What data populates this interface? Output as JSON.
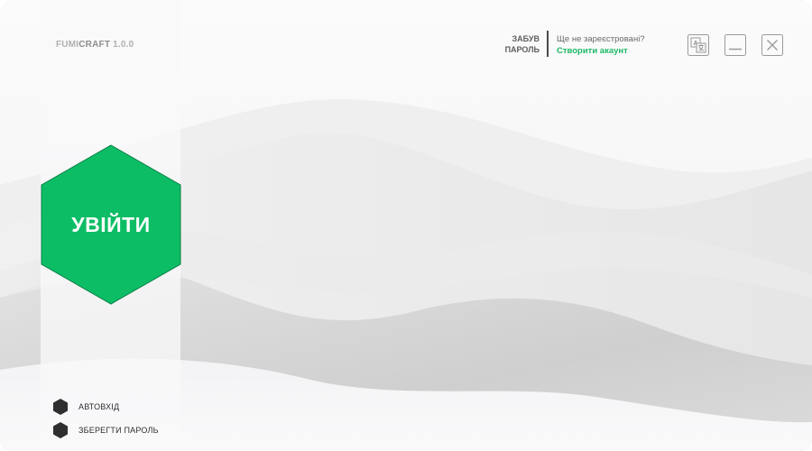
{
  "app": {
    "brand_light": "FUMI",
    "brand_bold": "CRAFT",
    "version": "1.0.0"
  },
  "login": {
    "button_label": "УВІЙТИ",
    "accent_color": "#0dbd65"
  },
  "header": {
    "forgot_password_line1": "ЗАБУВ",
    "forgot_password_line2": "ПАРОЛЬ",
    "not_registered": "Ще не зареєстровані?",
    "create_account": "Створити акаунт",
    "link_color": "#1db866"
  },
  "window_controls": [
    {
      "icon": "translate-icon",
      "action": "language"
    },
    {
      "icon": "minimize-icon",
      "action": "minimize"
    },
    {
      "icon": "close-icon",
      "action": "close"
    }
  ],
  "options": {
    "autologin_label": "АВТОВХІД",
    "save_password_label": "ЗБЕРЕГТИ ПАРОЛЬ"
  }
}
